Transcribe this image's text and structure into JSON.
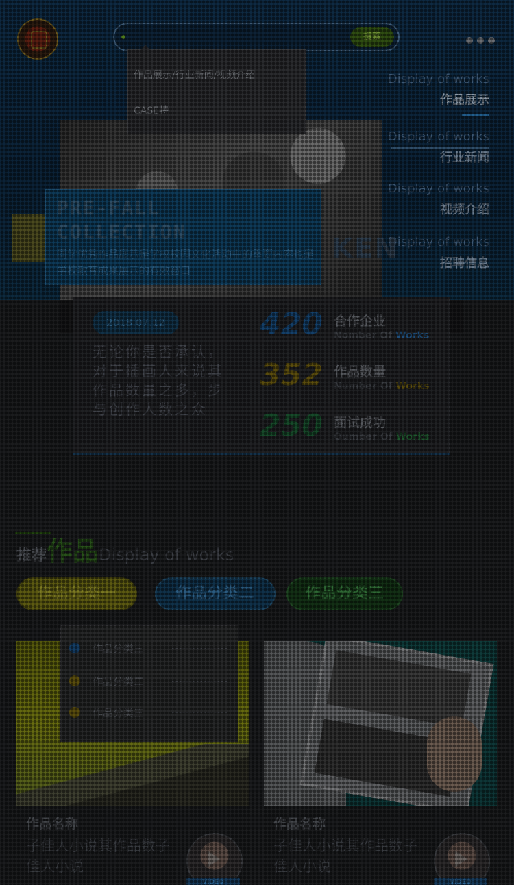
{
  "header": {
    "search_button": "搜索",
    "search_dropdown": [
      "作品展示/行业新闻/视频介绍",
      "CASE特"
    ]
  },
  "side_nav": [
    {
      "en": "Display of works",
      "zh": "作品展示",
      "active": true
    },
    {
      "en": "Display of works",
      "zh": "行业新闻",
      "active": false
    },
    {
      "en": "Display of works",
      "zh": "视频介绍",
      "active": false
    },
    {
      "en": "Display of works",
      "zh": "招聘信息",
      "active": false
    }
  ],
  "promo": {
    "title_1": "PRE-FALL",
    "title_2": "COLLECTION",
    "subtitle": "同学优秀作品展示是学校校园文化活动中的重要内容也是学校教育成果展示的有效窗口"
  },
  "hero_text": "KEN",
  "stats": {
    "date": "2018.07.12",
    "description": "无论你是否承认，对于插画人来说其作品数量之多，步与创作人数之众",
    "items": [
      {
        "number": "420",
        "zh": "合作企业",
        "en_prefix": "Nomber Of",
        "en_highlight": "Works",
        "color": "#14406a",
        "hl_color": "#1f4f7c"
      },
      {
        "number": "352",
        "zh": "作品数量",
        "en_prefix": "Number Of",
        "en_highlight": "Works",
        "color": "#5b4d0e",
        "hl_color": "#5b4d0e"
      },
      {
        "number": "250",
        "zh": "面试成功",
        "en_prefix": "Oumber Of",
        "en_highlight": "Works",
        "color": "#174a2a",
        "hl_color": "#1f5a2f"
      }
    ]
  },
  "section": {
    "prefix": "推荐",
    "title": "作品",
    "en": "Display of works"
  },
  "tabs": [
    "作品分类一",
    "作品分类二",
    "作品分类三"
  ],
  "category_dropdown": [
    {
      "label": "作品分类三",
      "color": "#143e66"
    },
    {
      "label": "作品分类二",
      "color": "#5a4d0e"
    },
    {
      "label": "作品分类三",
      "color": "#5a4d0e"
    }
  ],
  "cards": [
    {
      "title": "作品名称",
      "desc": "子佳人小说其作品数子佳人小说",
      "video": "VIDEO"
    },
    {
      "title": "作品名称",
      "desc": "子佳人小说其作品数子佳人小说",
      "video": "VIDEO"
    }
  ],
  "colors": {
    "accent_blue": "#14406a",
    "accent_yellow": "#5c5a12",
    "accent_green": "#28521a"
  }
}
